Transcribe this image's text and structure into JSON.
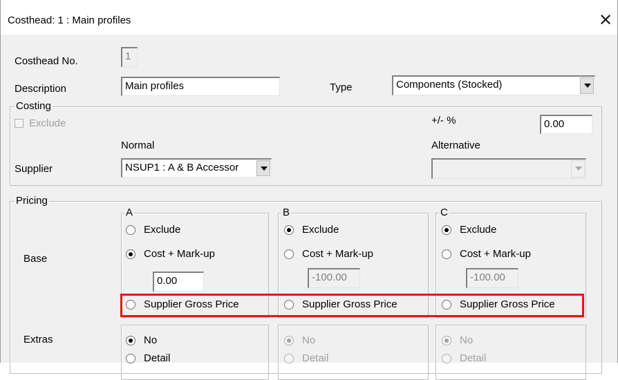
{
  "window": {
    "title": "Costhead: 1  : Main profiles",
    "close_glyph": "✕"
  },
  "header": {
    "costhead_no_label": "Costhead No.",
    "costhead_no_value": "1",
    "description_label": "Description",
    "description_value": "Main profiles",
    "type_label": "Type",
    "type_value": "Components (Stocked)"
  },
  "costing": {
    "legend": "Costing",
    "exclude_label": "Exclude",
    "plus_minus_label": "+/-  %",
    "plus_minus_value": "0.00",
    "normal_label": "Normal",
    "alternative_label": "Alternative",
    "supplier_label": "Supplier",
    "supplier_value": "NSUP1 : A & B Accessor",
    "alternative_value": ""
  },
  "pricing": {
    "legend": "Pricing",
    "base_label": "Base",
    "extras_label": "Extras",
    "columns": [
      {
        "legend": "A",
        "exclude_label": "Exclude",
        "exclude_selected": false,
        "cost_markup_label": "Cost + Mark-up",
        "cost_markup_selected": true,
        "markup_value": "0.00",
        "gross_price_label": "Supplier Gross Price",
        "gross_price_selected": false,
        "extras_no_label": "No",
        "extras_detail_label": "Detail"
      },
      {
        "legend": "B",
        "exclude_label": "Exclude",
        "exclude_selected": true,
        "cost_markup_label": "Cost + Mark-up",
        "cost_markup_selected": false,
        "markup_value": "-100.00",
        "gross_price_label": "Supplier Gross Price",
        "gross_price_selected": false,
        "extras_no_label": "No",
        "extras_detail_label": "Detail"
      },
      {
        "legend": "C",
        "exclude_label": "Exclude",
        "exclude_selected": true,
        "cost_markup_label": "Cost + Mark-up",
        "cost_markup_selected": false,
        "markup_value": "-100.00",
        "gross_price_label": "Supplier Gross Price",
        "gross_price_selected": false,
        "extras_no_label": "No",
        "extras_detail_label": "Detail"
      }
    ]
  },
  "colors": {
    "highlight": "#e11818",
    "dialog_bg": "#f0f0f0"
  }
}
